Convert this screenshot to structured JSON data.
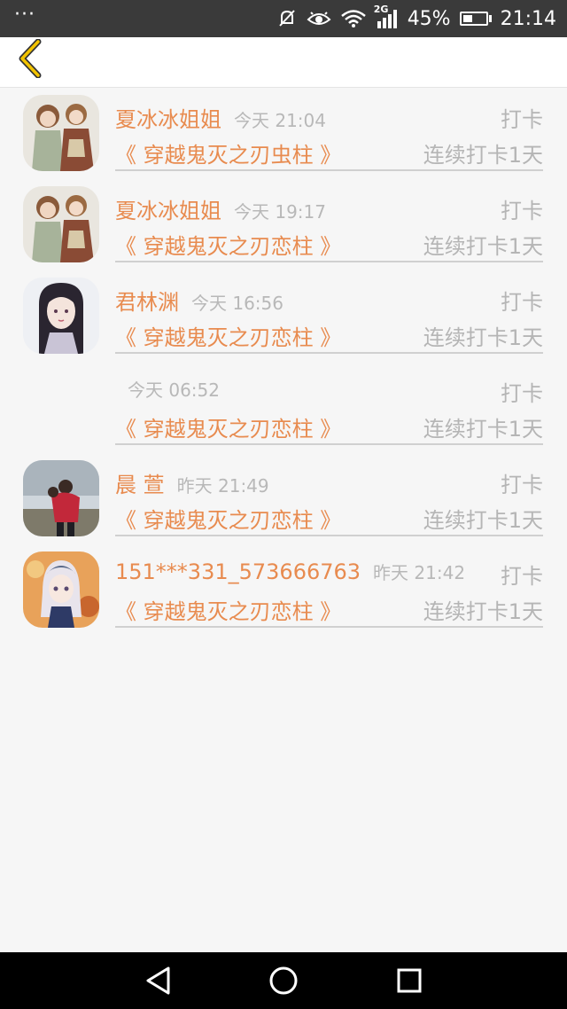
{
  "status_bar": {
    "menu_dots": "···",
    "network_label": "2G",
    "battery_percent": "45%",
    "battery_level": 0.45,
    "time": "21:14",
    "icons": [
      "mute-icon",
      "eye-comfort-icon",
      "wifi-icon",
      "signal-icon",
      "battery-icon"
    ]
  },
  "header": {
    "back_icon": "chevron-left-icon",
    "accent_color": "#f2c300"
  },
  "entries": [
    {
      "name": "夏冰冰姐姐",
      "time": "今天 21:04",
      "action": "打卡",
      "book": "《 穿越鬼灭之刃虫柱 》",
      "streak": "连续打卡1天",
      "avatar": "illustrated-pair"
    },
    {
      "name": "夏冰冰姐姐",
      "time": "今天 19:17",
      "action": "打卡",
      "book": "《 穿越鬼灭之刃恋柱 》",
      "streak": "连续打卡1天",
      "avatar": "illustrated-pair"
    },
    {
      "name": "君林渊",
      "time": "今天 16:56",
      "action": "打卡",
      "book": "《 穿越鬼灭之刃恋柱 》",
      "streak": "连续打卡1天",
      "avatar": "anime-woman"
    },
    {
      "name": "",
      "time": "今天 06:52",
      "action": "打卡",
      "book": "《 穿越鬼灭之刃恋柱 》",
      "streak": "连续打卡1天",
      "avatar": "none"
    },
    {
      "name": "晨 萱",
      "time": "昨天 21:49",
      "action": "打卡",
      "book": "《 穿越鬼灭之刃恋柱 》",
      "streak": "连续打卡1天",
      "avatar": "photo"
    },
    {
      "name": "151***331_573666763",
      "time": "昨天 21:42",
      "action": "打卡",
      "book": "《 穿越鬼灭之刃恋柱 》",
      "streak": "连续打卡1天",
      "avatar": "anime-girl"
    }
  ],
  "colors": {
    "name_accent": "#e88b4f",
    "muted_text": "#b5b5b5",
    "status_bar_bg": "#3a3a3a",
    "page_bg": "#f6f6f6"
  },
  "nav_bar": {
    "icons": [
      "back-triangle-icon",
      "home-circle-icon",
      "recents-square-icon"
    ]
  }
}
